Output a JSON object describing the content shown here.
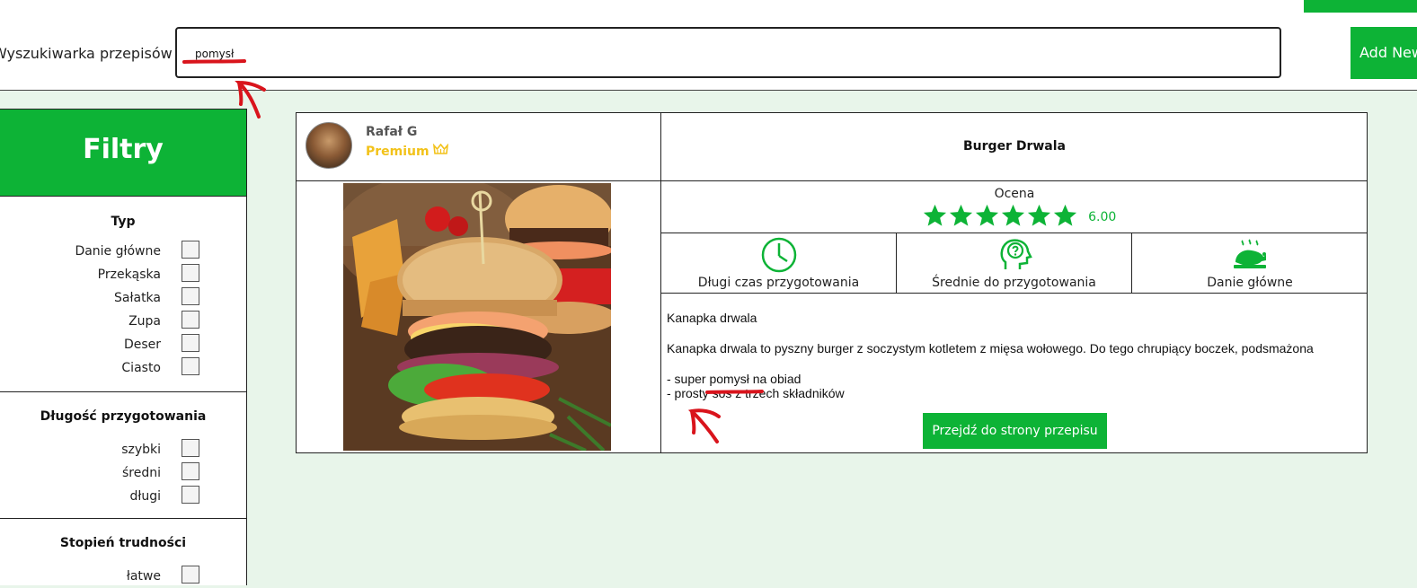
{
  "header": {
    "search_label": "Wyszukiwarka przepisów",
    "search_value": "pomysł",
    "add_button": "Add New"
  },
  "sidebar": {
    "title": "Filtry",
    "groups": [
      {
        "title": "Typ",
        "options": [
          "Danie główne",
          "Przekąska",
          "Sałatka",
          "Zupa",
          "Deser",
          "Ciasto"
        ]
      },
      {
        "title": "Długość przygotowania",
        "options": [
          "szybki",
          "średni",
          "długi"
        ]
      },
      {
        "title": "Stopień trudności",
        "options": [
          "łatwe"
        ]
      }
    ]
  },
  "recipe": {
    "author": "Rafał G",
    "premium": "Premium",
    "title": "Burger Drwala",
    "rating_label": "Ocena",
    "rating_value": "6.00",
    "stars": 6,
    "info": [
      "Długi czas przygotowania",
      "Średnie do przygotowania",
      "Danie główne"
    ],
    "desc_title": "Kanapka drwala",
    "desc_body": "Kanapka drwala to pyszny burger z soczystym kotletem z mięsa wołowego. Do tego chrupiący boczek, podsmażona",
    "desc_lines": [
      "- super pomysł na obiad",
      "- prosty sos z trzech składników"
    ],
    "goto_button": "Przejdź do strony przepisu"
  },
  "colors": {
    "accent": "#0db336",
    "premium": "#f2c21a",
    "annotation": "#d9141c",
    "background": "#e8f5ea"
  },
  "icons": [
    "clock-icon",
    "head-question-icon",
    "roast-chicken-icon",
    "crown-icon",
    "star-icon"
  ]
}
